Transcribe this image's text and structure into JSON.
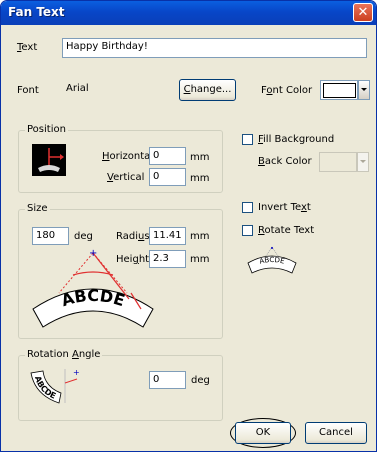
{
  "window": {
    "title": "Fan Text",
    "close_symbol": "✕"
  },
  "text_row": {
    "label_u": "T",
    "label_rest": "ext",
    "value": "Happy Birthday!"
  },
  "font_row": {
    "label": "Font",
    "value": "Arial",
    "change_u": "C",
    "change_rest": "hange...",
    "color_label_pre": "F",
    "color_label_u": "o",
    "color_label_post": "nt Color",
    "color_swatch": "#ffffff"
  },
  "position": {
    "title": "Position",
    "horizontal_u": "H",
    "horizontal_rest": "orizontal",
    "horizontal_value": "0",
    "vertical_u": "V",
    "vertical_rest": "ertical",
    "vertical_value": "0",
    "unit": "mm"
  },
  "size": {
    "title": "Size",
    "deg_value": "180",
    "deg_unit": "deg",
    "radius_pre": "Radi",
    "radius_u": "u",
    "radius_post": "s",
    "radius_value": "11.41",
    "height_pre": "Hei",
    "height_u": "g",
    "height_post": "ht",
    "height_value": "2.3",
    "unit": "mm",
    "preview_text": "ABCDE"
  },
  "rotation": {
    "title_pre": "Rotation ",
    "title_u": "A",
    "title_post": "ngle",
    "value": "0",
    "unit": "deg",
    "preview_text": "ABCDE"
  },
  "options": {
    "fill_u": "F",
    "fill_rest": "ill Background",
    "back_u": "B",
    "back_rest": "ack Color",
    "invert_pre": "Invert Te",
    "invert_u": "x",
    "invert_post": "t",
    "rotate_u": "R",
    "rotate_rest": "otate Text",
    "small_preview_text": "ABCDE"
  },
  "buttons": {
    "ok": "OK",
    "cancel": "Cancel"
  }
}
